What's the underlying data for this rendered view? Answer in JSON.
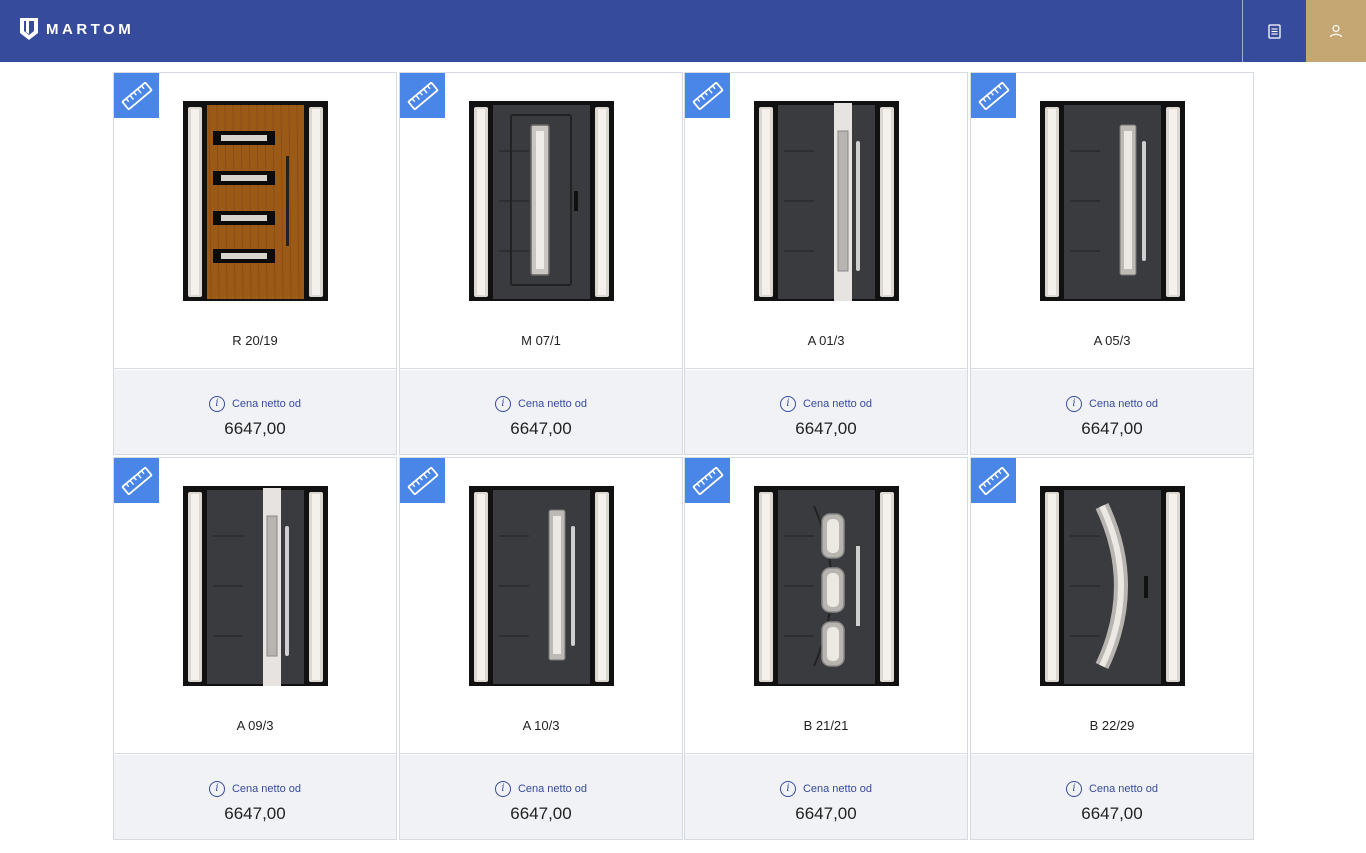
{
  "header": {
    "brand": "MARTOM",
    "brand_color": "#374b9d",
    "accent_color": "#c5a774",
    "actions": [
      {
        "icon": "document-icon"
      },
      {
        "icon": "user-icon"
      }
    ]
  },
  "products": [
    {
      "name": "R 20/19",
      "price_label": "Cena netto od",
      "price": "6647,00",
      "style": "wood",
      "glass": "horizontal"
    },
    {
      "name": "M 07/1",
      "price_label": "Cena netto od",
      "price": "6647,00",
      "style": "dark",
      "glass": "panel"
    },
    {
      "name": "A 01/3",
      "price_label": "Cena netto od",
      "price": "6647,00",
      "style": "dark",
      "glass": "center-strip"
    },
    {
      "name": "A 05/3",
      "price_label": "Cena netto od",
      "price": "6647,00",
      "style": "dark",
      "glass": "narrow"
    },
    {
      "name": "A 09/3",
      "price_label": "Cena netto od",
      "price": "6647,00",
      "style": "dark",
      "glass": "center-strip"
    },
    {
      "name": "A 10/3",
      "price_label": "Cena netto od",
      "price": "6647,00",
      "style": "dark",
      "glass": "narrow"
    },
    {
      "name": "B 21/21",
      "price_label": "Cena netto od",
      "price": "6647,00",
      "style": "dark",
      "glass": "arc-segments"
    },
    {
      "name": "B 22/29",
      "price_label": "Cena netto od",
      "price": "6647,00",
      "style": "dark",
      "glass": "arc"
    }
  ]
}
